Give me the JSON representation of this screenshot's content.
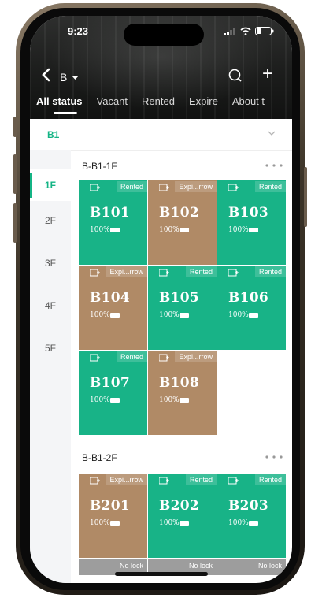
{
  "status_bar": {
    "time": "9:23"
  },
  "nav": {
    "back_icon": "chevron-left-icon",
    "building": "B",
    "building_caret_icon": "caret-down-icon",
    "search_icon": "search-icon",
    "add_label": "+"
  },
  "tabs": [
    {
      "label": "All status",
      "active": true
    },
    {
      "label": "Vacant"
    },
    {
      "label": "Rented"
    },
    {
      "label": "Expire"
    },
    {
      "label": "About t"
    }
  ],
  "block": {
    "label": "B1"
  },
  "floors": [
    "1F",
    "2F",
    "3F",
    "4F",
    "5F"
  ],
  "sections": [
    {
      "title": "B-B1-1F",
      "rooms": [
        {
          "num": "B101",
          "status": "Rented",
          "pct": "100%",
          "color": "#18b387"
        },
        {
          "num": "B102",
          "status": "Expi...rrow",
          "pct": "100%",
          "color": "#b08a66"
        },
        {
          "num": "B103",
          "status": "Rented",
          "pct": "100%",
          "color": "#18b387"
        },
        {
          "num": "B104",
          "status": "Expi...rrow",
          "pct": "100%",
          "color": "#b08a66"
        },
        {
          "num": "B105",
          "status": "Rented",
          "pct": "100%",
          "color": "#18b387"
        },
        {
          "num": "B106",
          "status": "Rented",
          "pct": "100%",
          "color": "#18b387"
        },
        {
          "num": "B107",
          "status": "Rented",
          "pct": "100%",
          "color": "#18b387"
        },
        {
          "num": "B108",
          "status": "Expi...rrow",
          "pct": "100%",
          "color": "#b08a66"
        }
      ]
    },
    {
      "title": "B-B1-2F",
      "rooms": [
        {
          "num": "B201",
          "status": "Expi...rrow",
          "pct": "100%",
          "color": "#b08a66"
        },
        {
          "num": "B202",
          "status": "Rented",
          "pct": "100%",
          "color": "#18b387"
        },
        {
          "num": "B203",
          "status": "Rented",
          "pct": "100%",
          "color": "#18b387"
        }
      ],
      "no_lock": [
        "No lock",
        "No lock",
        "No lock"
      ]
    }
  ],
  "colors": {
    "accent": "#14b485",
    "rented": "#18b387",
    "expiring": "#b08a66",
    "no_lock": "#9d9d9d"
  }
}
